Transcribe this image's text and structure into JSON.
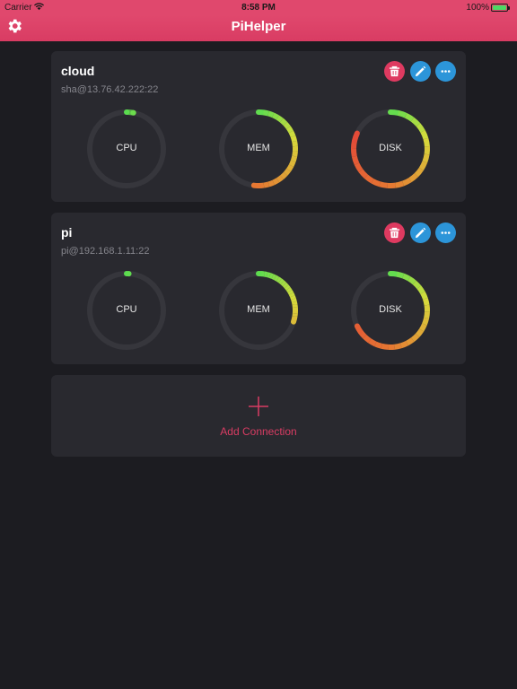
{
  "status_bar": {
    "carrier": "Carrier",
    "time": "8:58 PM",
    "battery": "100%"
  },
  "nav": {
    "title": "PiHelper",
    "settings_icon": "gear-icon"
  },
  "colors": {
    "accent": "#e0486d",
    "card_bg": "#29292f",
    "page_bg": "#1c1c21",
    "delete_button": "#de3a60",
    "action_button": "#2c95d9",
    "gauge_track": "#36363c"
  },
  "connections": [
    {
      "name": "cloud",
      "host": "sha@13.76.42.222:22",
      "gauges": [
        {
          "label": "CPU",
          "percent": 3
        },
        {
          "label": "MEM",
          "percent": 52
        },
        {
          "label": "DISK",
          "percent": 82
        }
      ]
    },
    {
      "name": "pi",
      "host": "pi@192.168.1.11:22",
      "gauges": [
        {
          "label": "CPU",
          "percent": 1
        },
        {
          "label": "MEM",
          "percent": 30
        },
        {
          "label": "DISK",
          "percent": 68
        }
      ]
    }
  ],
  "add_connection": {
    "label": "Add Connection"
  }
}
